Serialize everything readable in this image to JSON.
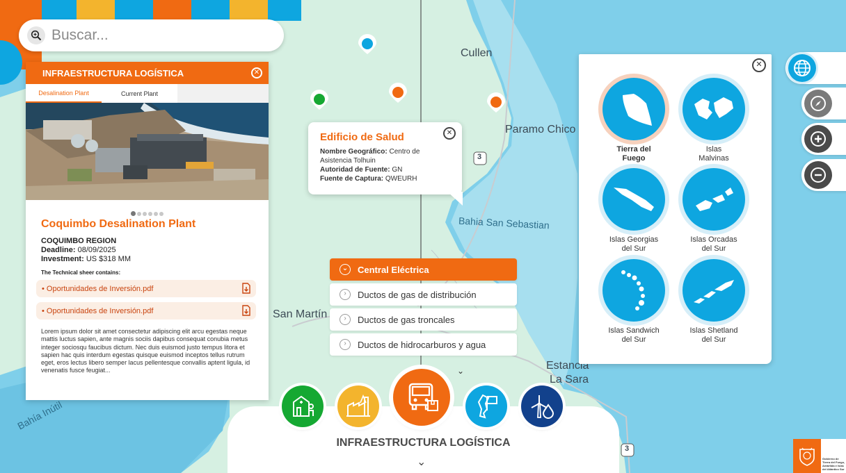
{
  "search": {
    "placeholder": "Buscar..."
  },
  "map_labels": {
    "cullen": "Cullen",
    "paramo_chico": "Paramo Chico",
    "bahia_san_sebastian": "Bahia San Sebastian",
    "san_martin": "San Martín",
    "estancia_la_sara_1": "Estancia",
    "estancia_la_sara_2": "La Sara",
    "bahia_inutil": "Bahía Inútil",
    "route_3a": "3",
    "route_3b": "3"
  },
  "card": {
    "header": "INFRAESTRUCTURA LOGÍSTICA",
    "tabs": [
      "Desalination Plant",
      "Current Plant"
    ],
    "active_tab": "Desalination Plant",
    "carousel_index": 1,
    "carousel_count": 6,
    "title": "Coquimbo Desalination Plant",
    "region": "COQUIMBO REGION",
    "deadline_label": "Deadline:",
    "deadline": "08/09/2025",
    "investment_label": "Investment:",
    "investment": "US $318 MM",
    "sheet_label": "The Technical sheer contains:",
    "files": [
      "• Oportunidades de Inversión.pdf",
      "• Oportunidades de Inversión.pdf"
    ],
    "description": "Lorem ipsum dolor sit amet consectetur adipiscing elit arcu egestas neque mattis luctus sapien, ante magnis sociis dapibus consequat conubia metus integer sociosqu faucibus dictum. Nec duis euismod justo tempus litora et sapien hac quis interdum egestas quisque euismod inceptos tellus rutrum eget, eros lectus libero semper lacus pellentesque convallis aptent ligula, id venenatis fusce feugiat..."
  },
  "popup": {
    "title": "Edificio de Salud",
    "rows": [
      {
        "label": "Nombre Geográfico:",
        "value": "Centro de"
      },
      {
        "label": "",
        "value": "Asistencia Tolhuin"
      },
      {
        "label": "Autoridad de Fuente:",
        "value": "GN"
      },
      {
        "label": "Fuente de Captura:",
        "value": "QWEURH"
      }
    ]
  },
  "layers_menu": {
    "items": [
      "Central Eléctrica",
      "Ductos de gas de distribución",
      "Ductos de gas troncales",
      "Ductos de hidrocarburos y agua"
    ],
    "active": "Central Eléctrica",
    "more_icon": "chevron-down-icon"
  },
  "bottom_bar": {
    "title": "INFRAESTRUCTURA LOGÍSTICA",
    "categories": [
      {
        "name": "health",
        "icon": "hospital-icon",
        "color": "#15a832"
      },
      {
        "name": "industry",
        "icon": "factory-icon",
        "color": "#f3b42d"
      },
      {
        "name": "logistics",
        "icon": "truck-icon",
        "color": "#f06a12"
      },
      {
        "name": "territory",
        "icon": "map-flag-icon",
        "color": "#0ea6e0"
      },
      {
        "name": "energy",
        "icon": "wind-water-icon",
        "color": "#12418c"
      }
    ],
    "selected": "logistics"
  },
  "regions_panel": {
    "items": [
      {
        "line1": "Tierra del",
        "line2": "Fuego"
      },
      {
        "line1": "Islas",
        "line2": "Malvinas"
      },
      {
        "line1": "Islas Georgias",
        "line2": "del Sur"
      },
      {
        "line1": "Islas Orcadas",
        "line2": "del Sur"
      },
      {
        "line1": "Islas Sandwich",
        "line2": "del Sur"
      },
      {
        "line1": "Islas Shetland",
        "line2": "del Sur"
      }
    ],
    "selected": "Tierra del Fuego"
  },
  "controls": [
    "globe-icon",
    "compass-icon",
    "zoom-in-icon",
    "zoom-out-icon"
  ],
  "colors": {
    "accent": "#f06a12",
    "sea": "#7fcfea",
    "land": "#d6f0e2",
    "region_blue": "#0ea6e0"
  },
  "logo": {
    "text": "Gobierno de Tierra del Fuego, Antártida e Islas del Atlántico Sur"
  }
}
